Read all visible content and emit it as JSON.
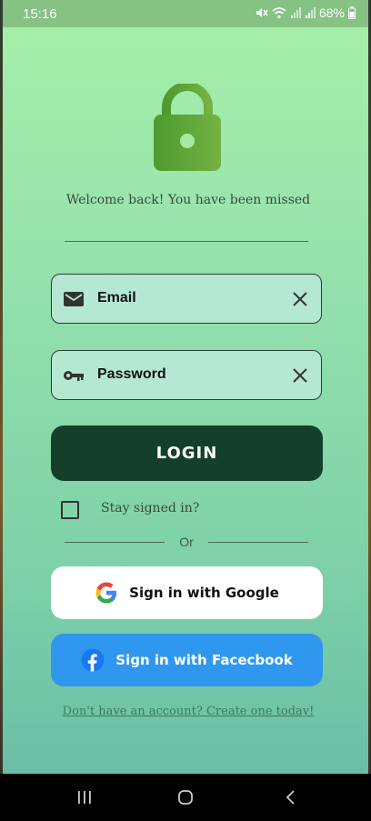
{
  "status_bar": {
    "time": "15:16",
    "battery": "68%",
    "icons": [
      "mute-icon",
      "wifi-icon",
      "signal-icon",
      "signal-icon",
      "battery-icon"
    ]
  },
  "header": {
    "icon": "lock-icon",
    "welcome_text": "Welcome back! You have been missed"
  },
  "form": {
    "email": {
      "placeholder": "Email",
      "icon": "mail-icon",
      "clear_icon": "close-icon"
    },
    "password": {
      "placeholder": "Password",
      "icon": "key-icon",
      "clear_icon": "close-icon"
    },
    "login_label": "LOGIN",
    "stay_signed_in_label": "Stay signed in?",
    "stay_signed_in_checked": false
  },
  "separator": {
    "label": "Or"
  },
  "social": {
    "google_label": "Sign in with Google",
    "facebook_label": "Sign in with Facecbook"
  },
  "footer": {
    "signup_link": "Don't have an account? Create one today!"
  },
  "nav": {
    "icons": [
      "recent-apps-icon",
      "home-icon",
      "back-icon"
    ]
  },
  "colors": {
    "background_top": "#a6f0a8",
    "background_bottom": "#66baa6",
    "login_button": "#143f2a",
    "facebook_button": "#2f98ee",
    "field_background": "#b5e8d2",
    "lock_green": "#5fa83a"
  }
}
